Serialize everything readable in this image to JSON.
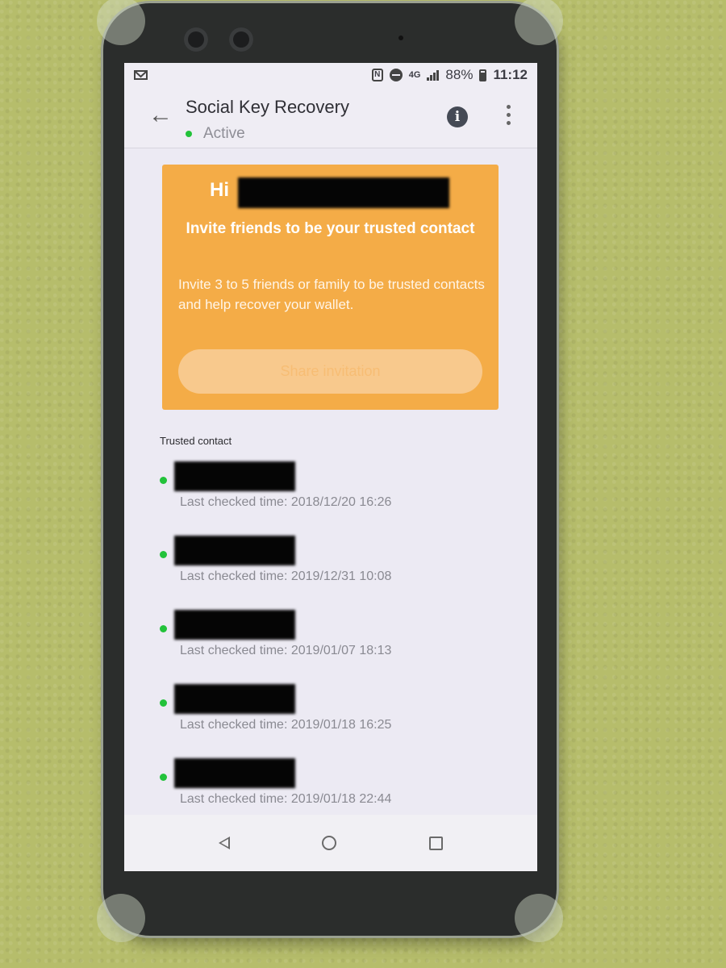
{
  "status_bar": {
    "notification_icon": "gmail-icon",
    "icons": [
      "nfc-icon",
      "do-not-disturb-icon",
      "4g-icon",
      "signal-icon"
    ],
    "network": "4G",
    "battery": "88%",
    "time": "11:12"
  },
  "app_bar": {
    "title": "Social Key Recovery",
    "status": "Active",
    "status_color": "#22c23a",
    "back_icon": "arrow-left-icon",
    "info_icon": "info-icon",
    "menu_icon": "more-vert-icon"
  },
  "invite_card": {
    "greeting": "Hi",
    "heading": "Invite friends to be your trusted contact",
    "body": "Invite 3 to 5 friends or family to be trusted contacts and help recover your wallet.",
    "button_label": "Share invitation",
    "background_color": "#f4ac47"
  },
  "trusted_contacts": {
    "section_label": "Trusted contact",
    "items": [
      {
        "last_checked": "Last checked time: 2018/12/20 16:26"
      },
      {
        "last_checked": "Last checked time: 2019/12/31 10:08"
      },
      {
        "last_checked": "Last checked time: 2019/01/07 18:13"
      },
      {
        "last_checked": "Last checked time: 2019/01/18 16:25"
      },
      {
        "last_checked": "Last checked time: 2019/01/18 22:44"
      }
    ]
  },
  "nav_bar": {
    "buttons": [
      "back-triangle-icon",
      "home-circle-icon",
      "recents-square-icon"
    ]
  }
}
